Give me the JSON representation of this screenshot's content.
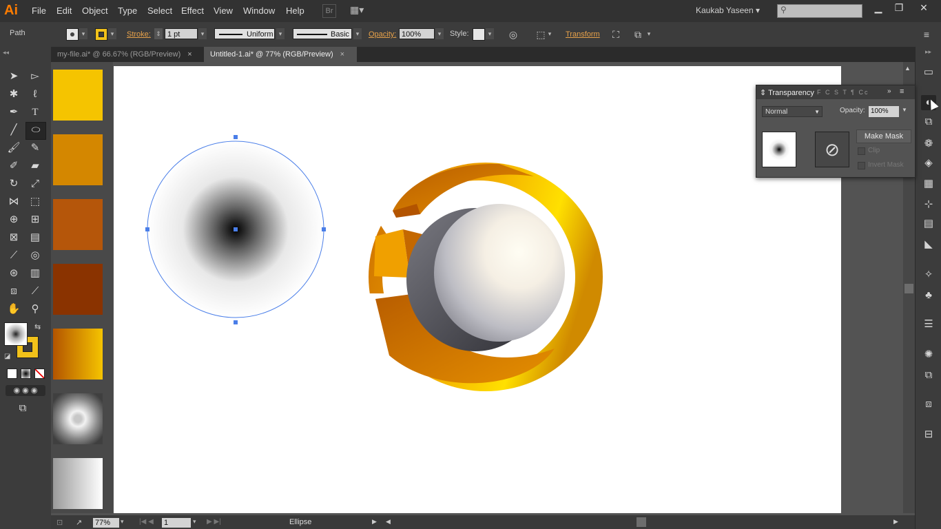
{
  "menubar": {
    "logo": "Ai",
    "items": [
      "File",
      "Edit",
      "Object",
      "Type",
      "Select",
      "Effect",
      "View",
      "Window",
      "Help"
    ],
    "user": "Kaukab Yaseen",
    "user_caret": "▾"
  },
  "controlbar": {
    "selection_type": "Path",
    "stroke_label": "Stroke:",
    "stroke_weight": "1 pt",
    "profile_label": "Uniform",
    "brush_label": "Basic",
    "opacity_label": "Opacity:",
    "opacity_value": "100%",
    "style_label": "Style:",
    "transform_label": "Transform"
  },
  "tabs": [
    {
      "label": "my-file.ai* @ 66.67% (RGB/Preview)",
      "close": "×"
    },
    {
      "label": "Untitled-1.ai* @ 77% (RGB/Preview)",
      "close": "×"
    }
  ],
  "swatches": {
    "colors": [
      "#f5c400",
      "#d48700",
      "#b5560a",
      "#8a3300"
    ]
  },
  "transparency_panel": {
    "title": "Transparency",
    "other_tabs": "F C S T ¶ Cc",
    "blend_mode": "Normal",
    "opacity_label": "Opacity:",
    "opacity_value": "100%",
    "make_mask": "Make Mask",
    "clip": "Clip",
    "invert_mask": "Invert Mask"
  },
  "statusbar": {
    "zoom": "77%",
    "page": "1",
    "tool_name": "Ellipse"
  },
  "colors": {
    "accent_orange": "#ff7c00",
    "selection_blue": "#4a7ee8",
    "stroke_yellow": "#f2c21a"
  }
}
